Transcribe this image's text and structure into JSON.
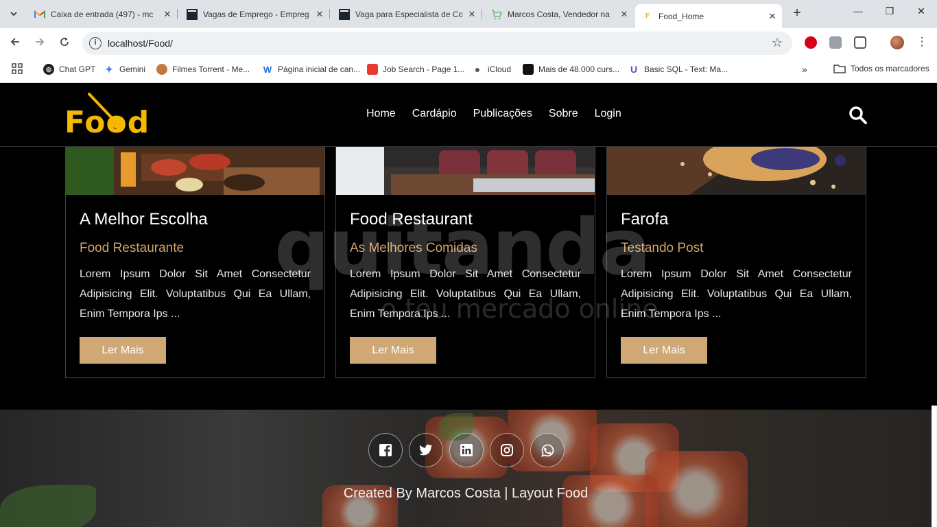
{
  "browser": {
    "tabs": [
      {
        "title": "Caixa de entrada (497) - mc",
        "favicon": "gmail-icon"
      },
      {
        "title": "Vagas de Emprego - Empreg",
        "favicon": "job-icon"
      },
      {
        "title": "Vaga para Especialista de Co",
        "favicon": "job-icon"
      },
      {
        "title": "Marcos Costa, Vendedor na",
        "favicon": "cart-icon"
      },
      {
        "title": "Food_Home",
        "favicon": "food-icon"
      }
    ],
    "url": "localhost/Food/",
    "bookmarks": [
      "Chat GPT",
      "Gemini",
      "Filmes Torrent - Me...",
      "Página inicial de can...",
      "Job Search - Page 1...",
      "iCloud",
      "Mais de 48.000 curs...",
      "Basic SQL - Text: Ma..."
    ],
    "all_bookmarks": "Todos os marcadores"
  },
  "site": {
    "logo": "Food",
    "nav": [
      "Home",
      "Cardápio",
      "Publicações",
      "Sobre",
      "Login"
    ]
  },
  "cards": [
    {
      "title": "A Melhor Escolha",
      "subtitle": "Food Restaurante",
      "text": "Lorem Ipsum Dolor Sit Amet Consectetur Adipisicing Elit. Voluptatibus Qui Ea Ullam, Enim Tempora Ips ...",
      "button": "Ler Mais"
    },
    {
      "title": "Food Restaurant",
      "subtitle": "As Melhores Comidas",
      "text": "Lorem Ipsum Dolor Sit Amet Consectetur Adipisicing Elit. Voluptatibus Qui Ea Ullam, Enim Tempora Ips ...",
      "button": "Ler Mais"
    },
    {
      "title": "Farofa",
      "subtitle": "Testando Post",
      "text": "Lorem Ipsum Dolor Sit Amet Consectetur Adipisicing Elit. Voluptatibus Qui Ea Ullam, Enim Tempora Ips ...",
      "button": "Ler Mais"
    }
  ],
  "watermark": {
    "big": "quitanda",
    "small": "o teu mercado online"
  },
  "footer": {
    "socials": [
      "facebook-icon",
      "twitter-icon",
      "linkedin-icon",
      "instagram-icon",
      "whatsapp-icon"
    ],
    "credit": "Created By Marcos Costa | Layout Food"
  },
  "colors": {
    "accent": "#cfa876",
    "logo": "#f5b800",
    "subtitle": "#d4a46a"
  }
}
